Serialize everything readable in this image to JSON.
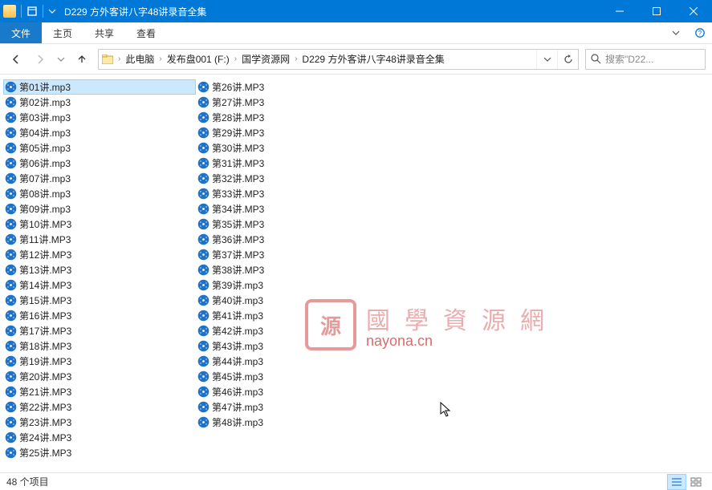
{
  "titlebar": {
    "title": "D229 方外客讲八字48讲录音全集"
  },
  "ribbon": {
    "file": "文件",
    "tabs": [
      "主页",
      "共享",
      "查看"
    ]
  },
  "breadcrumbs": [
    "此电脑",
    "发布盘001 (F:)",
    "国学资源网",
    "D229 方外客讲八字48讲录音全集"
  ],
  "search": {
    "placeholder": "搜索\"D22..."
  },
  "watermark": {
    "seal": "源",
    "cn": "國學資源網",
    "url": "nayona.cn"
  },
  "statusbar": {
    "count": "48 个项目"
  },
  "files_col1": [
    "第01讲.mp3",
    "第02讲.mp3",
    "第03讲.mp3",
    "第04讲.mp3",
    "第05讲.mp3",
    "第06讲.mp3",
    "第07讲.mp3",
    "第08讲.mp3",
    "第09讲.mp3",
    "第10讲.MP3",
    "第11讲.MP3",
    "第12讲.MP3",
    "第13讲.MP3",
    "第14讲.MP3",
    "第15讲.MP3",
    "第16讲.MP3",
    "第17讲.MP3",
    "第18讲.MP3",
    "第19讲.MP3",
    "第20讲.MP3",
    "第21讲.MP3",
    "第22讲.MP3",
    "第23讲.MP3",
    "第24讲.MP3",
    "第25讲.MP3"
  ],
  "files_col2": [
    "第26讲.MP3",
    "第27讲.MP3",
    "第28讲.MP3",
    "第29讲.MP3",
    "第30讲.MP3",
    "第31讲.MP3",
    "第32讲.MP3",
    "第33讲.MP3",
    "第34讲.MP3",
    "第35讲.MP3",
    "第36讲.MP3",
    "第37讲.MP3",
    "第38讲.MP3",
    "第39讲.mp3",
    "第40讲.mp3",
    "第41讲.mp3",
    "第42讲.mp3",
    "第43讲.mp3",
    "第44讲.mp3",
    "第45讲.mp3",
    "第46讲.mp3",
    "第47讲.mp3",
    "第48讲.mp3"
  ]
}
